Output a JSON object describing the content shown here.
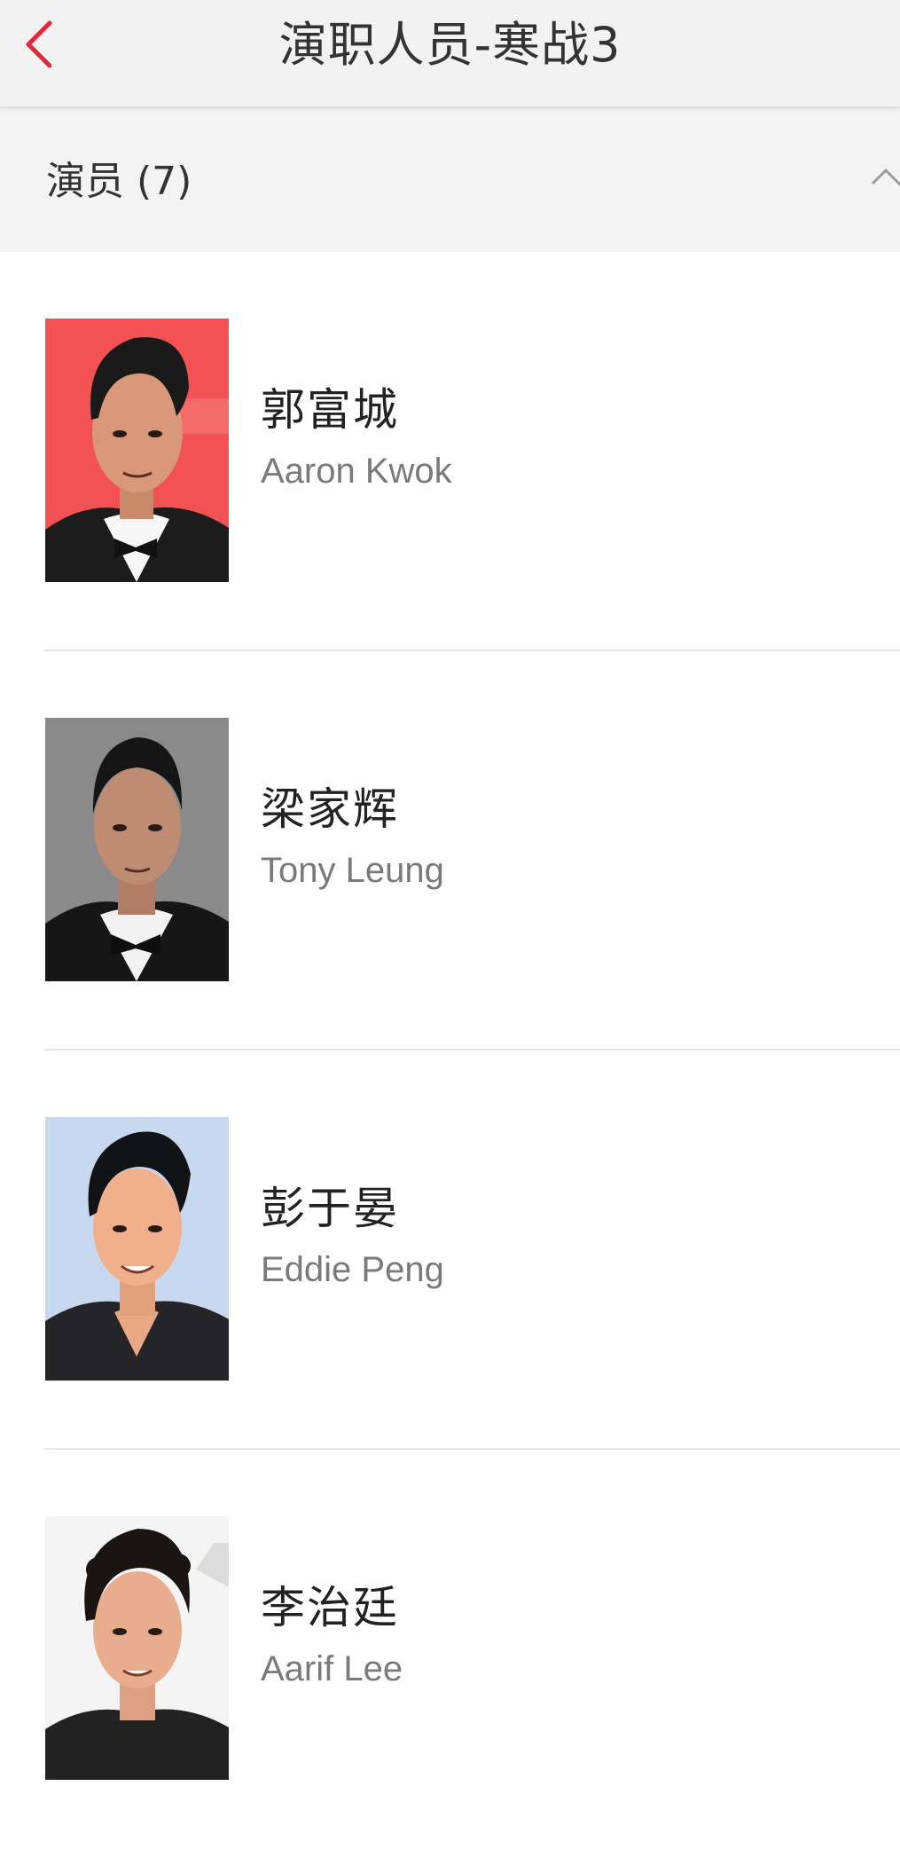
{
  "header": {
    "title": "演职人员-寒战3",
    "back_icon": "chevron-left-icon",
    "accent_color": "#e0283a"
  },
  "section": {
    "label": "演员 (7)",
    "toggle_icon": "chevron-up-icon"
  },
  "cast": [
    {
      "name_cn": "郭富城",
      "name_en": "Aaron Kwok",
      "photo_bg": "#f25253"
    },
    {
      "name_cn": "梁家辉",
      "name_en": "Tony Leung",
      "photo_bg": "#8a8a8a"
    },
    {
      "name_cn": "彭于晏",
      "name_en": "Eddie Peng",
      "photo_bg": "#c8d8ef"
    },
    {
      "name_cn": "李治廷",
      "name_en": "Aarif Lee",
      "photo_bg": "#f4f4f4"
    }
  ]
}
